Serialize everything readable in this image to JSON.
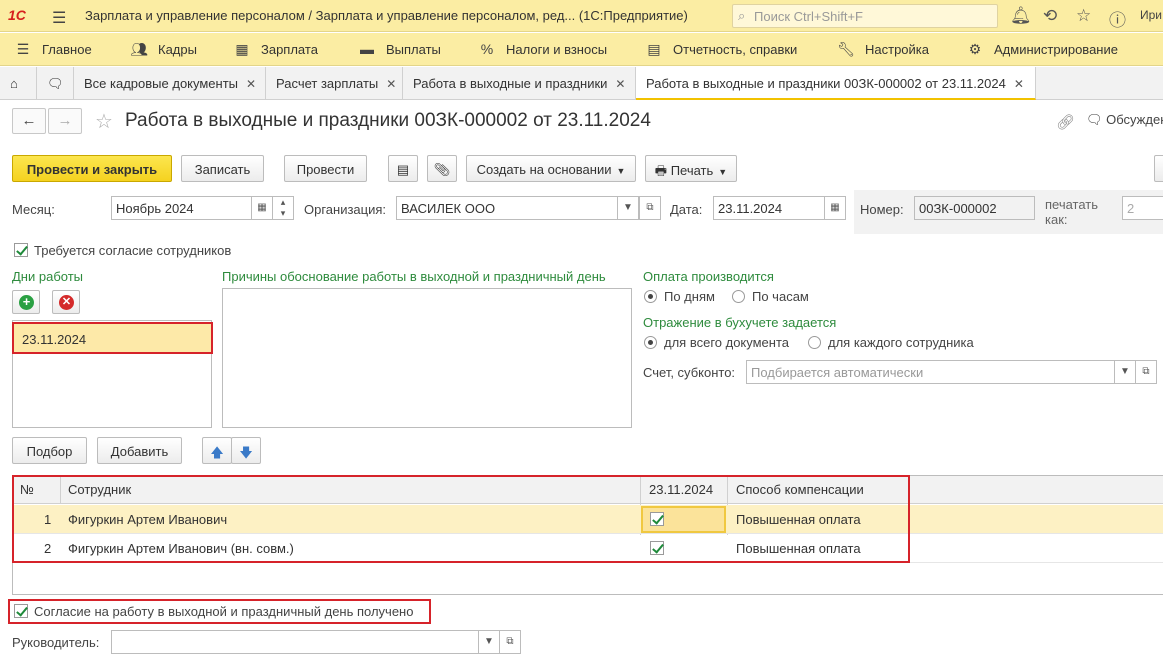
{
  "app": {
    "logo": "1С",
    "title": "Зарплата и управление персоналом / Зарплата и управление персоналом, ред... (1С:Предприятие)",
    "search_placeholder": "Поиск Ctrl+Shift+F",
    "user": "Ири"
  },
  "menu": [
    "Главное",
    "Кадры",
    "Зарплата",
    "Выплаты",
    "Налоги и взносы",
    "Отчетность, справки",
    "Настройка",
    "Администрирование"
  ],
  "tabs": [
    {
      "label": "Все кадровые документы"
    },
    {
      "label": "Расчет зарплаты"
    },
    {
      "label": "Работа в выходные и праздники"
    },
    {
      "label": "Работа в выходные и праздники 00ЗК-000002 от 23.11.2024"
    }
  ],
  "document": {
    "title": "Работа в выходные и праздники 00ЗК-000002 от 23.11.2024",
    "discuss": "Обсуждение"
  },
  "toolbar": {
    "post_close": "Провести и закрыть",
    "save": "Записать",
    "post": "Провести",
    "create_based": "Создать на основании",
    "print": "Печать"
  },
  "header_fields": {
    "month_label": "Месяц:",
    "month_value": "Ноябрь 2024",
    "org_label": "Организация:",
    "org_value": "ВАСИЛЕК ООО",
    "date_label": "Дата:",
    "date_value": "23.11.2024",
    "number_label": "Номер:",
    "number_value": "00ЗК-000002",
    "print_as_label": "печатать как:",
    "print_as_value": "2"
  },
  "consent_required": {
    "label": "Требуется согласие сотрудников",
    "checked": true
  },
  "workdays": {
    "label": "Дни работы",
    "items": [
      "23.11.2024"
    ]
  },
  "reasons": {
    "label": "Причины обоснование работы в выходной и праздничный день",
    "value": ""
  },
  "payment": {
    "label": "Оплата производится",
    "options": [
      "По дням",
      "По часам"
    ],
    "selected": "По дням"
  },
  "accounting": {
    "label": "Отражение в бухучете задается",
    "options": [
      "для всего документа",
      "для каждого сотрудника"
    ],
    "selected": "для всего документа",
    "account_label": "Счет, субконто:",
    "account_placeholder": "Подбирается автоматически"
  },
  "table_buttons": {
    "pick": "Подбор",
    "add": "Добавить"
  },
  "table": {
    "columns": [
      "№",
      "Сотрудник",
      "23.11.2024",
      "Способ компенсации"
    ],
    "rows": [
      {
        "n": "1",
        "employee": "Фигуркин Артем Иванович",
        "worked": true,
        "compensation": "Повышенная оплата"
      },
      {
        "n": "2",
        "employee": "Фигуркин Артем Иванович (вн. совм.)",
        "worked": true,
        "compensation": "Повышенная оплата"
      }
    ]
  },
  "consent_received": {
    "label": "Согласие на работу в выходной и праздничный день получено",
    "checked": true
  },
  "manager": {
    "label": "Руководитель:",
    "value": ""
  },
  "colors": {
    "accent_yellow": "#fbeda3",
    "primary_button": "#f5d21f",
    "highlight_red": "#d6232a",
    "green_text": "#2e8b3d"
  }
}
